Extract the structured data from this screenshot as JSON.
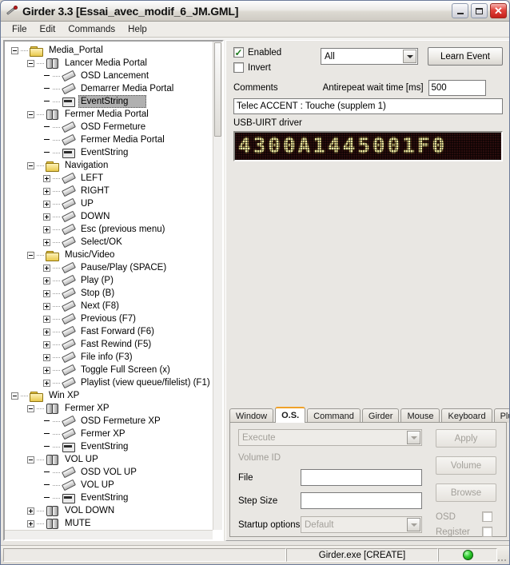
{
  "window": {
    "title": "Girder 3.3 [Essai_avec_modif_6_JM.GML]",
    "app_icon": "girder-icon",
    "minimize_label": "–",
    "maximize_label": "□",
    "close_label": "✕"
  },
  "menu": {
    "items": [
      {
        "label": "File"
      },
      {
        "label": "Edit"
      },
      {
        "label": "Commands"
      },
      {
        "label": "Help"
      }
    ]
  },
  "tree": {
    "nodes": [
      {
        "label": "Media_Portal",
        "depth": 0,
        "icon": "folder",
        "expander": "minus",
        "selected": false
      },
      {
        "label": "Lancer Media Portal",
        "depth": 1,
        "icon": "macro",
        "expander": "minus",
        "selected": false
      },
      {
        "label": "OSD Lancement",
        "depth": 2,
        "icon": "cmd",
        "expander": "none",
        "selected": false
      },
      {
        "label": "Demarrer Media Portal",
        "depth": 2,
        "icon": "cmd",
        "expander": "none",
        "selected": false
      },
      {
        "label": "EventString",
        "depth": 2,
        "icon": "evt",
        "expander": "none",
        "selected": true
      },
      {
        "label": "Fermer Media Portal",
        "depth": 1,
        "icon": "macro",
        "expander": "minus",
        "selected": false
      },
      {
        "label": "OSD Fermeture",
        "depth": 2,
        "icon": "cmd",
        "expander": "none",
        "selected": false
      },
      {
        "label": "Fermer Media Portal",
        "depth": 2,
        "icon": "cmd",
        "expander": "none",
        "selected": false
      },
      {
        "label": "EventString",
        "depth": 2,
        "icon": "evt",
        "expander": "none",
        "selected": false
      },
      {
        "label": "Navigation",
        "depth": 1,
        "icon": "folder",
        "expander": "minus",
        "selected": false
      },
      {
        "label": "LEFT",
        "depth": 2,
        "icon": "cmd",
        "expander": "plus",
        "selected": false
      },
      {
        "label": "RIGHT",
        "depth": 2,
        "icon": "cmd",
        "expander": "plus",
        "selected": false
      },
      {
        "label": "UP",
        "depth": 2,
        "icon": "cmd",
        "expander": "plus",
        "selected": false
      },
      {
        "label": "DOWN",
        "depth": 2,
        "icon": "cmd",
        "expander": "plus",
        "selected": false
      },
      {
        "label": "Esc (previous menu)",
        "depth": 2,
        "icon": "cmd",
        "expander": "plus",
        "selected": false
      },
      {
        "label": "Select/OK",
        "depth": 2,
        "icon": "cmd",
        "expander": "plus",
        "selected": false
      },
      {
        "label": "Music/Video",
        "depth": 1,
        "icon": "folder",
        "expander": "minus",
        "selected": false
      },
      {
        "label": "Pause/Play (SPACE)",
        "depth": 2,
        "icon": "cmd",
        "expander": "plus",
        "selected": false
      },
      {
        "label": "Play (P)",
        "depth": 2,
        "icon": "cmd",
        "expander": "plus",
        "selected": false
      },
      {
        "label": "Stop (B)",
        "depth": 2,
        "icon": "cmd",
        "expander": "plus",
        "selected": false
      },
      {
        "label": "Next (F8)",
        "depth": 2,
        "icon": "cmd",
        "expander": "plus",
        "selected": false
      },
      {
        "label": "Previous (F7)",
        "depth": 2,
        "icon": "cmd",
        "expander": "plus",
        "selected": false
      },
      {
        "label": "Fast Forward (F6)",
        "depth": 2,
        "icon": "cmd",
        "expander": "plus",
        "selected": false
      },
      {
        "label": "Fast Rewind (F5)",
        "depth": 2,
        "icon": "cmd",
        "expander": "plus",
        "selected": false
      },
      {
        "label": "File info (F3)",
        "depth": 2,
        "icon": "cmd",
        "expander": "plus",
        "selected": false
      },
      {
        "label": "Toggle Full Screen (x)",
        "depth": 2,
        "icon": "cmd",
        "expander": "plus",
        "selected": false
      },
      {
        "label": "Playlist (view queue/filelist) (F1)",
        "depth": 2,
        "icon": "cmd",
        "expander": "plus",
        "selected": false
      },
      {
        "label": "Win XP",
        "depth": 0,
        "icon": "folder",
        "expander": "minus",
        "selected": false
      },
      {
        "label": "Fermer XP",
        "depth": 1,
        "icon": "macro",
        "expander": "minus",
        "selected": false
      },
      {
        "label": "OSD Fermeture XP",
        "depth": 2,
        "icon": "cmd",
        "expander": "none",
        "selected": false
      },
      {
        "label": "Fermer XP",
        "depth": 2,
        "icon": "cmd",
        "expander": "none",
        "selected": false
      },
      {
        "label": "EventString",
        "depth": 2,
        "icon": "evt",
        "expander": "none",
        "selected": false
      },
      {
        "label": "VOL UP",
        "depth": 1,
        "icon": "macro",
        "expander": "minus",
        "selected": false
      },
      {
        "label": "OSD VOL UP",
        "depth": 2,
        "icon": "cmd",
        "expander": "none",
        "selected": false
      },
      {
        "label": "VOL UP",
        "depth": 2,
        "icon": "cmd",
        "expander": "none",
        "selected": false
      },
      {
        "label": "EventString",
        "depth": 2,
        "icon": "evt",
        "expander": "none",
        "selected": false
      },
      {
        "label": "VOL DOWN",
        "depth": 1,
        "icon": "macro",
        "expander": "plus",
        "selected": false
      },
      {
        "label": "MUTE",
        "depth": 1,
        "icon": "macro",
        "expander": "plus",
        "selected": false
      }
    ]
  },
  "event": {
    "enabled_label": "Enabled",
    "enabled_checked": true,
    "invert_label": "Invert",
    "invert_checked": false,
    "device_filter_value": "All",
    "learn_event_label": "Learn Event",
    "antirepeat_label": "Antirepeat wait time [ms]",
    "antirepeat_value": "500",
    "comments_label": "Comments",
    "comments_value": "Telec ACCENT : Touche (supplem 1)",
    "driver_label": "USB-UIRT driver",
    "lcd_code": "4300A1445001F0"
  },
  "tabs": {
    "items": [
      {
        "label": "Window",
        "active": false
      },
      {
        "label": "O.S.",
        "active": true
      },
      {
        "label": "Command",
        "active": false
      },
      {
        "label": "Girder",
        "active": false
      },
      {
        "label": "Mouse",
        "active": false
      },
      {
        "label": "Keyboard",
        "active": false
      },
      {
        "label": "Plugins",
        "active": false
      }
    ]
  },
  "os_tab": {
    "action_value": "Execute",
    "volume_id_label": "Volume ID",
    "file_label": "File",
    "file_value": "",
    "step_size_label": "Step Size",
    "step_size_value": "",
    "startup_options_label": "Startup options",
    "startup_options_value": "Default",
    "apply_label": "Apply",
    "volume_label": "Volume",
    "browse_label": "Browse",
    "osd_label": "OSD",
    "osd_checked": false,
    "register_label": "Register",
    "register_checked": false
  },
  "statusbar": {
    "left_text": "",
    "center_text": "Girder.exe [CREATE]",
    "led_state": "green"
  },
  "colors": {
    "accent_tab": "#f0a22a",
    "lcd_background": "#2a0c0c",
    "lcd_text": "#f2eaa0",
    "selection": "#b0b0b0",
    "status_led": "#2ecb2e"
  }
}
